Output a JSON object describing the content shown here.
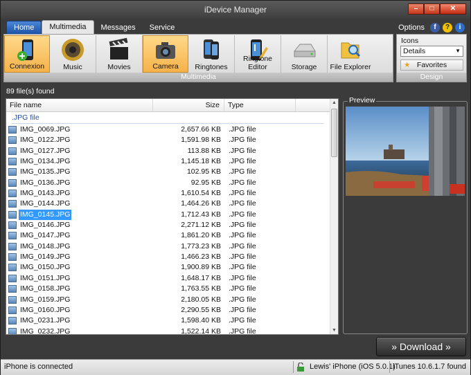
{
  "window": {
    "title": "iDevice Manager"
  },
  "tabs": [
    "Home",
    "Multimedia",
    "Messages",
    "Service"
  ],
  "options": {
    "label": "Options"
  },
  "ribbon": {
    "buttons": [
      "Connexion",
      "Music",
      "Movies",
      "Camera",
      "Ringtones",
      "Ringtone Editor",
      "Storage",
      "File Explorer"
    ],
    "group_label": "Multimedia"
  },
  "design": {
    "view_label": "Icons",
    "view_value": "Details",
    "favorites_label": "Favorites",
    "group_label": "Design"
  },
  "files": {
    "count_text": "89 file(s) found",
    "columns": {
      "name": "File name",
      "size": "Size",
      "type": "Type"
    },
    "group": ".JPG file",
    "rows": [
      {
        "name": "IMG_0069.JPG",
        "size": "2,657.66 KB",
        "type": ".JPG file"
      },
      {
        "name": "IMG_0122.JPG",
        "size": "1,591.98 KB",
        "type": ".JPG file"
      },
      {
        "name": "IMG_0127.JPG",
        "size": "113.88 KB",
        "type": ".JPG file"
      },
      {
        "name": "IMG_0134.JPG",
        "size": "1,145.18 KB",
        "type": ".JPG file"
      },
      {
        "name": "IMG_0135.JPG",
        "size": "102.95 KB",
        "type": ".JPG file"
      },
      {
        "name": "IMG_0136.JPG",
        "size": "92.95 KB",
        "type": ".JPG file"
      },
      {
        "name": "IMG_0143.JPG",
        "size": "1,610.54 KB",
        "type": ".JPG file"
      },
      {
        "name": "IMG_0144.JPG",
        "size": "1,464.26 KB",
        "type": ".JPG file"
      },
      {
        "name": "IMG_0145.JPG",
        "size": "1,712.43 KB",
        "type": ".JPG file"
      },
      {
        "name": "IMG_0146.JPG",
        "size": "2,271.12 KB",
        "type": ".JPG file"
      },
      {
        "name": "IMG_0147.JPG",
        "size": "1,861.20 KB",
        "type": ".JPG file"
      },
      {
        "name": "IMG_0148.JPG",
        "size": "1,773.23 KB",
        "type": ".JPG file"
      },
      {
        "name": "IMG_0149.JPG",
        "size": "1,466.23 KB",
        "type": ".JPG file"
      },
      {
        "name": "IMG_0150.JPG",
        "size": "1,900.89 KB",
        "type": ".JPG file"
      },
      {
        "name": "IMG_0151.JPG",
        "size": "1,648.17 KB",
        "type": ".JPG file"
      },
      {
        "name": "IMG_0158.JPG",
        "size": "1,763.55 KB",
        "type": ".JPG file"
      },
      {
        "name": "IMG_0159.JPG",
        "size": "2,180.05 KB",
        "type": ".JPG file"
      },
      {
        "name": "IMG_0160.JPG",
        "size": "2,290.55 KB",
        "type": ".JPG file"
      },
      {
        "name": "IMG_0231.JPG",
        "size": "1,598.40 KB",
        "type": ".JPG file"
      },
      {
        "name": "IMG_0232.JPG",
        "size": "1,522.14 KB",
        "type": ".JPG file"
      }
    ]
  },
  "preview": {
    "label": "Preview"
  },
  "download": {
    "label": "» Download »"
  },
  "status": {
    "connection": "iPhone is connected",
    "device": "Lewis' iPhone (iOS 5.0.1)",
    "itunes": "iTunes 10.6.1.7 found"
  },
  "colors": {
    "selection": "#3399ff",
    "ribbon_selected": "#f5b24a",
    "home_tab": "#1d54a8"
  }
}
